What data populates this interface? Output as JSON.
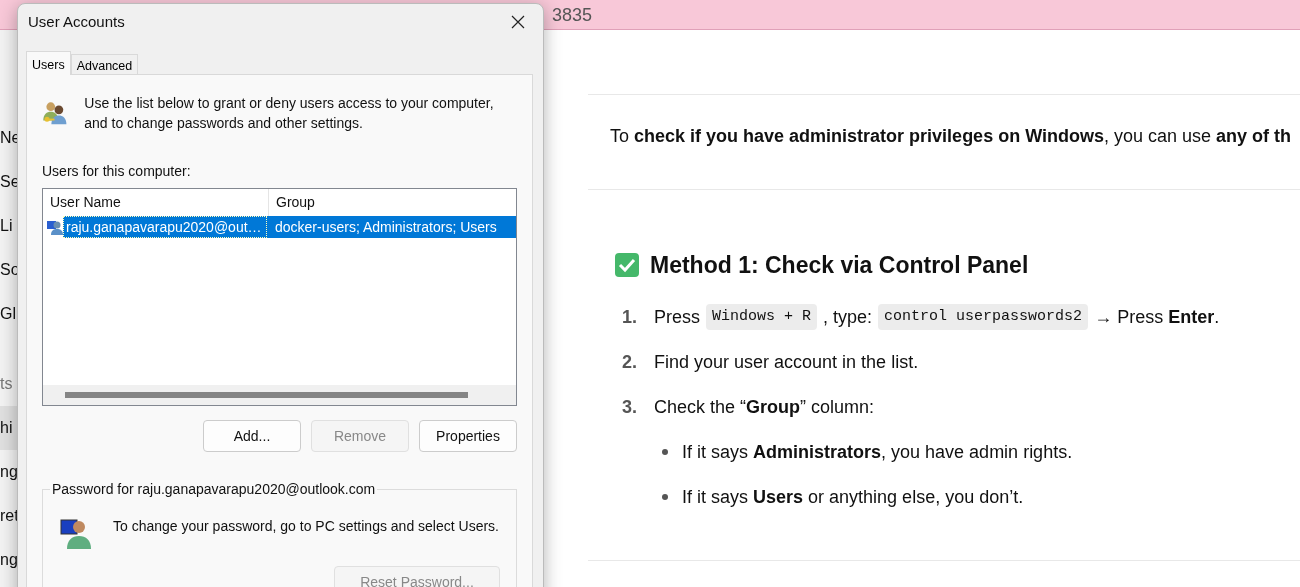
{
  "browser": {
    "address_fragment": "3835"
  },
  "sidebar": {
    "items": [
      {
        "label": "Ne",
        "kind": "item",
        "selected": false
      },
      {
        "label": "Se",
        "kind": "item",
        "selected": false
      },
      {
        "label": "Li",
        "kind": "item",
        "selected": false
      },
      {
        "label": "So",
        "kind": "item",
        "selected": false
      },
      {
        "label": "Gl",
        "kind": "item",
        "selected": false
      },
      {
        "label": "ts",
        "kind": "heading",
        "selected": false
      },
      {
        "label": "hi",
        "kind": "item",
        "selected": true
      },
      {
        "label": "ng",
        "kind": "item",
        "selected": false
      },
      {
        "label": "ret",
        "kind": "item",
        "selected": false
      },
      {
        "label": "ng",
        "kind": "item",
        "selected": false
      }
    ]
  },
  "article": {
    "intro": "To **check if you have administrator privileges on Windows**, you can use **any of th**",
    "heading": "Method 1: Check via Control Panel",
    "steps": [
      {
        "number": "1.",
        "parts": [
          {
            "kind": "text",
            "text": "Press"
          },
          {
            "kind": "code",
            "text": "Windows + R"
          },
          {
            "kind": "text",
            "text": ", type:"
          },
          {
            "kind": "code",
            "text": "control userpasswords2"
          },
          {
            "kind": "text",
            "text": "→ Press **Enter**."
          }
        ]
      },
      {
        "number": "2.",
        "parts": [
          {
            "kind": "text",
            "text": "Find your user account in the list."
          }
        ]
      },
      {
        "number": "3.",
        "parts": [
          {
            "kind": "text",
            "text": "Check the “**Group**” column:"
          }
        ]
      }
    ],
    "bullets": [
      "If it says **Administrators**, you have admin rights.",
      "If it says **Users** or anything else, you don’t."
    ]
  },
  "dialog": {
    "title": "User Accounts",
    "tabs": [
      {
        "label": "Users",
        "selected": true
      },
      {
        "label": "Advanced",
        "selected": false
      }
    ],
    "description": "Use the list below to grant or deny users access to your computer, and to change passwords and other settings.",
    "list_label": "Users for this computer:",
    "columns": [
      "User Name",
      "Group"
    ],
    "rows": [
      {
        "cells": [
          "raju.ganapavarapu2020@out…",
          "docker-users; Administrators; Users"
        ],
        "selected": true
      }
    ],
    "buttons": [
      {
        "label": "Add...",
        "disabled": false
      },
      {
        "label": "Remove",
        "disabled": true
      },
      {
        "label": "Properties",
        "disabled": false
      }
    ],
    "password_group": {
      "legend": "Password for raju.ganapavarapu2020@outlook.com",
      "text": "To change your password, go to PC settings and select Users.",
      "button": {
        "label": "Reset Password...",
        "disabled": true
      }
    }
  }
}
